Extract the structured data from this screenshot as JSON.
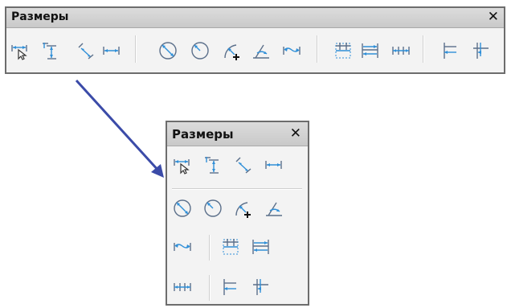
{
  "toolbar_large": {
    "title": "Размеры",
    "close": "✕",
    "buttons": [
      "linear-dimension-icon",
      "vertical-dimension-icon",
      "aligned-dimension-icon",
      "baseline-dimension-icon",
      "diameter-dimension-icon",
      "radius-dimension-icon",
      "arc-length-icon",
      "angular-dimension-icon",
      "arc-dimension-icon",
      "chain-dimension-box-icon",
      "continue-dimension-icon",
      "chain-dimension-icon",
      "ordinate-dimension-icon",
      "ordinate-baseline-icon"
    ]
  },
  "toolbar_small": {
    "title": "Размеры",
    "close": "✕",
    "buttons": [
      "linear-dimension-icon",
      "vertical-dimension-icon",
      "aligned-dimension-icon",
      "baseline-dimension-icon",
      "diameter-dimension-icon",
      "radius-dimension-icon",
      "arc-length-icon",
      "angular-dimension-icon",
      "arc-dimension-icon",
      "chain-dimension-box-icon",
      "continue-dimension-icon",
      "chain-dimension-icon",
      "ordinate-dimension-icon",
      "ordinate-baseline-icon"
    ]
  },
  "colors": {
    "arrow": "#3b4ba8",
    "icon_accent": "#2f8fd8",
    "icon_line": "#5b6f8a"
  }
}
